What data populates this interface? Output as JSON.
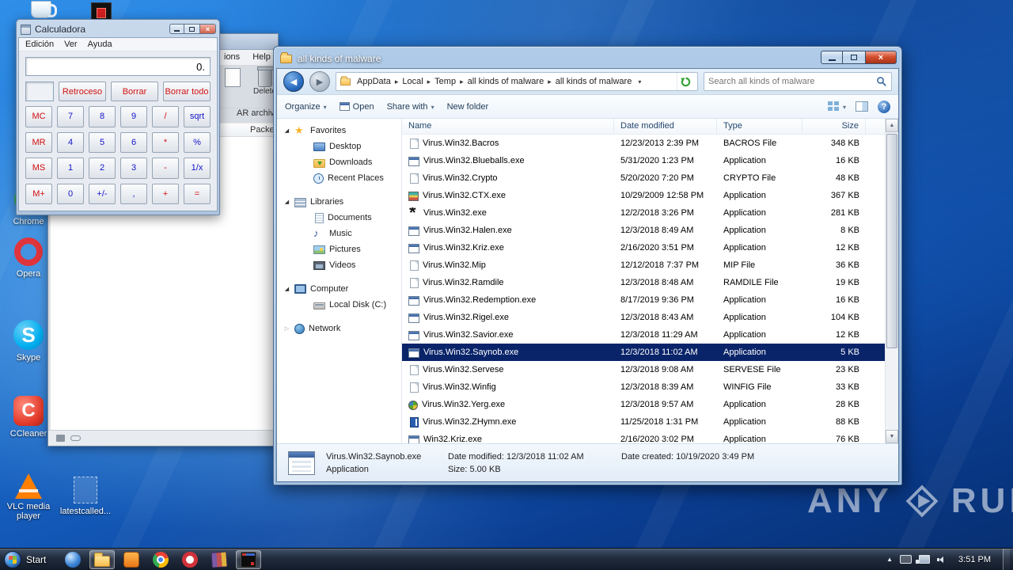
{
  "icons": {
    "search": "magnifier",
    "refresh": "green-circular-arrow",
    "help": "question-mark-circle",
    "breadcrumb_separator": "right-triangle",
    "back": "left-arrow-circle",
    "forward": "right-arrow-circle"
  },
  "desktop": {
    "icons": [
      {
        "id": "mug",
        "label": ""
      },
      {
        "id": "redapp",
        "label": ""
      },
      {
        "id": "firefox",
        "label": ""
      },
      {
        "id": "greenapp",
        "label": ""
      },
      {
        "id": "chrome",
        "label": "Chrome"
      },
      {
        "id": "opera",
        "label": "Opera"
      },
      {
        "id": "skype",
        "label": "Skype"
      },
      {
        "id": "ccleaner",
        "label": "CCleaner"
      },
      {
        "id": "vlc",
        "label": "VLC media player"
      },
      {
        "id": "latestcalled",
        "label": "latestcalled..."
      }
    ],
    "watermark": {
      "any": "ANY",
      "run": "RUN"
    }
  },
  "calculator": {
    "title": "Calculadora",
    "menu": [
      {
        "label": "Edición"
      },
      {
        "label": "Ver"
      },
      {
        "label": "Ayuda"
      }
    ],
    "display": "0.",
    "top_keys": [
      {
        "l": "Retroceso",
        "c": "r"
      },
      {
        "l": "Borrar",
        "c": "r"
      },
      {
        "l": "Borrar todo",
        "c": "r"
      }
    ],
    "keys": [
      {
        "l": "MC",
        "c": "r"
      },
      {
        "l": "7",
        "c": "b"
      },
      {
        "l": "8",
        "c": "b"
      },
      {
        "l": "9",
        "c": "b"
      },
      {
        "l": "/",
        "c": "r"
      },
      {
        "l": "sqrt",
        "c": "b"
      },
      {
        "l": "MR",
        "c": "r"
      },
      {
        "l": "4",
        "c": "b"
      },
      {
        "l": "5",
        "c": "b"
      },
      {
        "l": "6",
        "c": "b"
      },
      {
        "l": "*",
        "c": "r"
      },
      {
        "l": "%",
        "c": "b"
      },
      {
        "l": "MS",
        "c": "r"
      },
      {
        "l": "1",
        "c": "b"
      },
      {
        "l": "2",
        "c": "b"
      },
      {
        "l": "3",
        "c": "b"
      },
      {
        "l": "-",
        "c": "r"
      },
      {
        "l": "1/x",
        "c": "b"
      },
      {
        "l": "M+",
        "c": "r"
      },
      {
        "l": "0",
        "c": "b"
      },
      {
        "l": "+/-",
        "c": "b"
      },
      {
        "l": ",",
        "c": "b"
      },
      {
        "l": "+",
        "c": "r"
      },
      {
        "l": "=",
        "c": "r"
      }
    ]
  },
  "background_window": {
    "menu": [
      {
        "label": "ions"
      },
      {
        "label": "Help"
      }
    ],
    "delete_label": "Delete",
    "info_text": "AR archive, un",
    "packed_header": "Packed"
  },
  "explorer": {
    "title": "all kinds of malware",
    "address": {
      "crumbs": [
        {
          "label": "AppData"
        },
        {
          "label": "Local"
        },
        {
          "label": "Temp"
        },
        {
          "label": "all kinds of malware"
        },
        {
          "label": "all kinds of malware"
        }
      ],
      "search_placeholder": "Search all kinds of malware"
    },
    "toolbar": {
      "organize": "Organize",
      "open": "Open",
      "share": "Share with",
      "new_folder": "New folder"
    },
    "sidebar": [
      {
        "label": "Favorites",
        "icon": "i-fav",
        "arrow": "a-exp",
        "ind": "ind0"
      },
      {
        "label": "Desktop",
        "icon": "i-desktop",
        "arrow": "a-none",
        "ind": "ind1"
      },
      {
        "label": "Downloads",
        "icon": "i-down",
        "arrow": "a-none",
        "ind": "ind1"
      },
      {
        "label": "Recent Places",
        "icon": "i-recent",
        "arrow": "a-none",
        "ind": "ind1"
      },
      {
        "label": "Libraries",
        "icon": "i-lib",
        "arrow": "a-exp",
        "ind": "ind0 gap"
      },
      {
        "label": "Documents",
        "icon": "i-doc",
        "arrow": "a-none",
        "ind": "ind1"
      },
      {
        "label": "Music",
        "icon": "i-music",
        "arrow": "a-none",
        "ind": "ind1"
      },
      {
        "label": "Pictures",
        "icon": "i-pic",
        "arrow": "a-none",
        "ind": "ind1"
      },
      {
        "label": "Videos",
        "icon": "i-video",
        "arrow": "a-none",
        "ind": "ind1"
      },
      {
        "label": "Computer",
        "icon": "i-comp",
        "arrow": "a-exp",
        "ind": "ind0 gap"
      },
      {
        "label": "Local Disk (C:)",
        "icon": "i-disk",
        "arrow": "a-none",
        "ind": "ind1"
      },
      {
        "label": "Network",
        "icon": "i-net",
        "arrow": "a-col",
        "ind": "ind0 gap"
      }
    ],
    "columns": [
      {
        "label": "Name"
      },
      {
        "label": "Date modified"
      },
      {
        "label": "Type"
      },
      {
        "label": "Size"
      }
    ],
    "files": [
      {
        "name": "Virus.Win32.Bacros",
        "modified": "12/23/2013 2:39 PM",
        "type": "BACROS File",
        "size": "348 KB",
        "icon": "f-file"
      },
      {
        "name": "Virus.Win32.Blueballs.exe",
        "modified": "5/31/2020 1:23 PM",
        "type": "Application",
        "size": "16 KB",
        "icon": "f-app"
      },
      {
        "name": "Virus.Win32.Crypto",
        "modified": "5/20/2020 7:20 PM",
        "type": "CRYPTO File",
        "size": "48 KB",
        "icon": "f-file"
      },
      {
        "name": "Virus.Win32.CTX.exe",
        "modified": "10/29/2009 12:58 PM",
        "type": "Application",
        "size": "367 KB",
        "icon": "f-ctx"
      },
      {
        "name": "Virus.Win32.exe",
        "modified": "12/2/2018 3:26 PM",
        "type": "Application",
        "size": "281 KB",
        "icon": "f-star"
      },
      {
        "name": "Virus.Win32.Halen.exe",
        "modified": "12/3/2018 8:49 AM",
        "type": "Application",
        "size": "8 KB",
        "icon": "f-app"
      },
      {
        "name": "Virus.Win32.Kriz.exe",
        "modified": "2/16/2020 3:51 PM",
        "type": "Application",
        "size": "12 KB",
        "icon": "f-app"
      },
      {
        "name": "Virus.Win32.Mip",
        "modified": "12/12/2018 7:37 PM",
        "type": "MIP File",
        "size": "36 KB",
        "icon": "f-file"
      },
      {
        "name": "Virus.Win32.Ramdile",
        "modified": "12/3/2018 8:48 AM",
        "type": "RAMDILE File",
        "size": "19 KB",
        "icon": "f-file"
      },
      {
        "name": "Virus.Win32.Redemption.exe",
        "modified": "8/17/2019 9:36 PM",
        "type": "Application",
        "size": "16 KB",
        "icon": "f-app"
      },
      {
        "name": "Virus.Win32.Rigel.exe",
        "modified": "12/3/2018 8:43 AM",
        "type": "Application",
        "size": "104 KB",
        "icon": "f-app"
      },
      {
        "name": "Virus.Win32.Savior.exe",
        "modified": "12/3/2018 11:29 AM",
        "type": "Application",
        "size": "12 KB",
        "icon": "f-app"
      },
      {
        "name": "Virus.Win32.Saynob.exe",
        "modified": "12/3/2018 11:02 AM",
        "type": "Application",
        "size": "5 KB",
        "icon": "f-app",
        "sel": "selected"
      },
      {
        "name": "Virus.Win32.Servese",
        "modified": "12/3/2018 9:08 AM",
        "type": "SERVESE File",
        "size": "23 KB",
        "icon": "f-file"
      },
      {
        "name": "Virus.Win32.Winfig",
        "modified": "12/3/2018 8:39 AM",
        "type": "WINFIG File",
        "size": "33 KB",
        "icon": "f-file"
      },
      {
        "name": "Virus.Win32.Yerg.exe",
        "modified": "12/3/2018 9:57 AM",
        "type": "Application",
        "size": "28 KB",
        "icon": "f-gear"
      },
      {
        "name": "Virus.Win32.ZHymn.exe",
        "modified": "11/25/2018 1:31 PM",
        "type": "Application",
        "size": "88 KB",
        "icon": "f-book"
      },
      {
        "name": "Win32.Kriz.exe",
        "modified": "2/16/2020 3:02 PM",
        "type": "Application",
        "size": "76 KB",
        "icon": "f-app"
      }
    ],
    "details": {
      "name": "Virus.Win32.Saynob.exe",
      "modified": "Date modified: 12/3/2018 11:02 AM",
      "created": "Date created: 10/19/2020 3:49 PM",
      "type": "Application",
      "size": "Size: 5.00 KB"
    }
  },
  "taskbar": {
    "start": "Start",
    "time": "3:51 PM",
    "buttons": [
      {
        "id": "tb-blue"
      },
      {
        "id": "tb-folder",
        "state": "active"
      },
      {
        "id": "tb-orange"
      },
      {
        "id": "tb-chrome"
      },
      {
        "id": "tb-opera"
      },
      {
        "id": "tb-winrar"
      },
      {
        "id": "tb-console",
        "state": "active"
      }
    ]
  }
}
